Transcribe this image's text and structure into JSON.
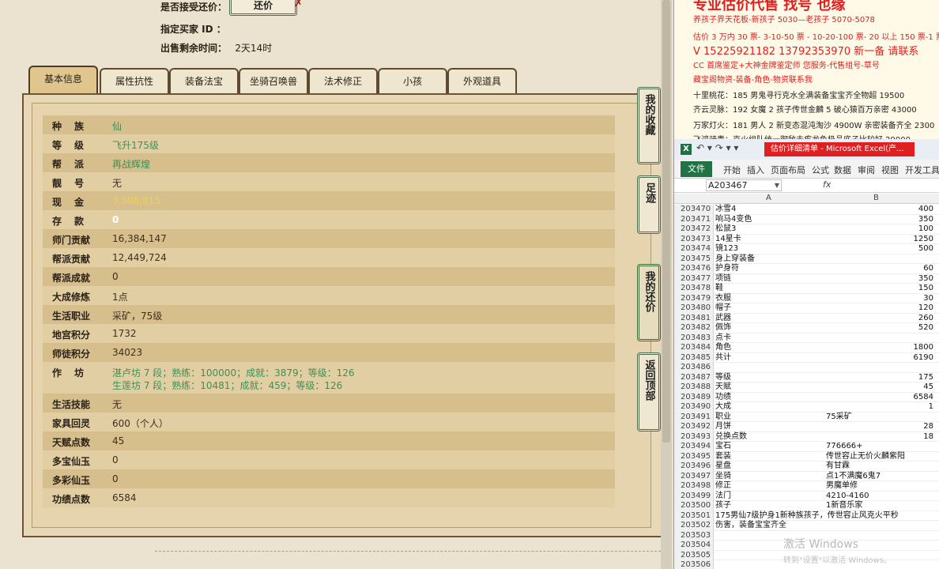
{
  "game": {
    "accept_counter_label": "是否接受还价：",
    "counter_button": "还价",
    "counter_close": "✗",
    "buyer_id_label": "指定买家 ID ：",
    "time_left_label": "出售剩余时间：",
    "time_left_value": "2天14时",
    "tabs": [
      "基本信息",
      "属性抗性",
      "装备法宝",
      "坐骑召唤兽",
      "法术修正",
      "小孩",
      "外观道具"
    ],
    "side_buttons": [
      "我的收藏",
      "足迹",
      "我的还价",
      "返回顶部"
    ],
    "rows": [
      {
        "label": "种族",
        "value": "仙",
        "color": "green",
        "wide": true
      },
      {
        "label": "等级",
        "value": "飞升175级",
        "color": "green",
        "wide": true
      },
      {
        "label": "帮派",
        "value": "再战辉煌",
        "color": "green",
        "wide": true
      },
      {
        "label": "靓号",
        "value": "无",
        "color": "brown",
        "wide": true
      },
      {
        "label": "现金",
        "value": "3,508,815",
        "color": "yellow",
        "wide": true
      },
      {
        "label": "存款",
        "value": "0",
        "color": "white",
        "wide": true
      },
      {
        "label": "师门贡献",
        "value": "16,384,147",
        "color": "brown"
      },
      {
        "label": "帮派贡献",
        "value": "12,449,724",
        "color": "brown"
      },
      {
        "label": "帮派成就",
        "value": "0",
        "color": "brown"
      },
      {
        "label": "大成修炼",
        "value": "1点",
        "color": "brown"
      },
      {
        "label": "生活职业",
        "value": "采矿，75级",
        "color": "brown"
      },
      {
        "label": "地宫积分",
        "value": "1732",
        "color": "brown"
      },
      {
        "label": "师徒积分",
        "value": "34023",
        "color": "brown"
      },
      {
        "label": "作坊",
        "value": "湛卢坊 7 段；熟练：100000；成就：3879；等级：126",
        "value2": "生莲坊 7 段；熟练：10481；成就：459；等级：126",
        "color": "green",
        "wide": true,
        "tall": true
      },
      {
        "label": "生活技能",
        "value": "无",
        "color": "brown"
      },
      {
        "label": "家具回灵",
        "value": "600（个人）",
        "color": "brown"
      },
      {
        "label": "天赋点数",
        "value": "45",
        "color": "brown"
      },
      {
        "label": "多宝仙玉",
        "value": "0",
        "color": "brown"
      },
      {
        "label": "多彩仙玉",
        "value": "0",
        "color": "brown"
      },
      {
        "label": "功绩点数",
        "value": "6584",
        "color": "brown"
      }
    ]
  },
  "notes": {
    "header": "专业估价代售 找号 也缘",
    "lines": [
      {
        "text": "养孩子界天花板-新孩子 5030—老孩子 5070-5078",
        "style": "red"
      },
      {
        "text": "估价 3 万内 30 票- 3-10-50 票 - 10-20-100 票- 20 以上 150 票-1 票",
        "style": "red"
      },
      {
        "text": "V 15225921182      13792353970   新一备 请联系",
        "style": "red big"
      },
      {
        "text": "CC 首席鉴定+大神金牌鉴定师 您服务-代售组号-草号",
        "style": "red"
      },
      {
        "text": "藏宝阁物资-装备-角色-物资联系我",
        "style": "red"
      },
      {
        "text": "十里桃花：185 男鬼寻行克水全满装备宝宝齐全物超 19500",
        "style": "black"
      },
      {
        "text": "齐云灵脉：192 女魔 2 孩子传世金麟 5 破心猿百万亲密 43000",
        "style": "black"
      },
      {
        "text": "万家灯火：181 男人 2 新变态混沌淘沙 4900W 亲密装备齐全 2300",
        "style": "black"
      },
      {
        "text": "飞鸿骑青：克火组队统一御敌去疾龙鱼极品底子比较好 29000",
        "style": "black"
      }
    ]
  },
  "excel": {
    "window_title": "估价详细清单 - Microsoft Excel(产...",
    "qa_icons": "↶ ▾  ↷ ▾ ▾",
    "file_tab": "文件",
    "ribbon_tabs": [
      "开始",
      "插入",
      "页面布局",
      "公式",
      "数据",
      "审阅",
      "视图",
      "开发工具"
    ],
    "name_box": "A203467",
    "fx": "fx",
    "col_a": "A",
    "col_b": "B",
    "rows": [
      {
        "n": "203470",
        "a": "冰雪4",
        "b": "400"
      },
      {
        "n": "203471",
        "a": "响马4变色",
        "b": "350"
      },
      {
        "n": "203472",
        "a": "松鼠3",
        "b": "100"
      },
      {
        "n": "203473",
        "a": "14星卡",
        "b": "1250"
      },
      {
        "n": "203474",
        "a": "镜123",
        "b": "500"
      },
      {
        "n": "203475",
        "a": "身上穿装备",
        "b": ""
      },
      {
        "n": "203476",
        "a": "护身符",
        "b": "60"
      },
      {
        "n": "203477",
        "a": "项链",
        "b": "350"
      },
      {
        "n": "203478",
        "a": "鞋",
        "b": "150"
      },
      {
        "n": "203479",
        "a": "衣服",
        "b": "30"
      },
      {
        "n": "203480",
        "a": "帽子",
        "b": "120"
      },
      {
        "n": "203481",
        "a": "武器",
        "b": "260"
      },
      {
        "n": "203482",
        "a": "佩饰",
        "b": "520"
      },
      {
        "n": "203483",
        "a": "点卡",
        "b": ""
      },
      {
        "n": "203484",
        "a": "角色",
        "b": "1800"
      },
      {
        "n": "203485",
        "a": "共计",
        "b": "6190"
      },
      {
        "n": "203486",
        "a": "",
        "b": ""
      },
      {
        "n": "203487",
        "a": "等级",
        "b": "175"
      },
      {
        "n": "203488",
        "a": "天赋",
        "b": "45"
      },
      {
        "n": "203489",
        "a": "功绩",
        "b": "6584"
      },
      {
        "n": "203490",
        "a": "大成",
        "b": "1"
      },
      {
        "n": "203491",
        "a": "职业",
        "b": "75采矿",
        "bt": true
      },
      {
        "n": "203492",
        "a": "月饼",
        "b": "28"
      },
      {
        "n": "203493",
        "a": "兑换点数",
        "b": "18"
      },
      {
        "n": "203494",
        "a": "宝石",
        "b": "776666+",
        "bt": true
      },
      {
        "n": "203495",
        "a": "套装",
        "b": "传世容止无价火麟紫阳",
        "bt": true
      },
      {
        "n": "203496",
        "a": "星盘",
        "b": "有甘霖",
        "bt": true
      },
      {
        "n": "203497",
        "a": "坐骑",
        "b": "点1不满魔6鬼7",
        "bt": true
      },
      {
        "n": "203498",
        "a": "修正",
        "b": "男魔单修",
        "bt": true
      },
      {
        "n": "203499",
        "a": "法门",
        "b": "4210-4160",
        "bt": true
      },
      {
        "n": "203500",
        "a": "孩子",
        "b": "1新音乐家",
        "bt": true
      },
      {
        "n": "203501",
        "a": "175男仙7级护身1新种族孩子，传世容止风克火平秒",
        "b": ""
      },
      {
        "n": "203502",
        "a": "伤害，装备宝宝齐全",
        "b": ""
      },
      {
        "n": "203503",
        "a": "",
        "b": ""
      },
      {
        "n": "203504",
        "a": "",
        "b": ""
      },
      {
        "n": "203505",
        "a": "",
        "b": ""
      },
      {
        "n": "203506",
        "a": "",
        "b": ""
      }
    ],
    "activate_title": "激活 Windows",
    "activate_sub": "转到\"设置\"以激活 Windows。"
  }
}
